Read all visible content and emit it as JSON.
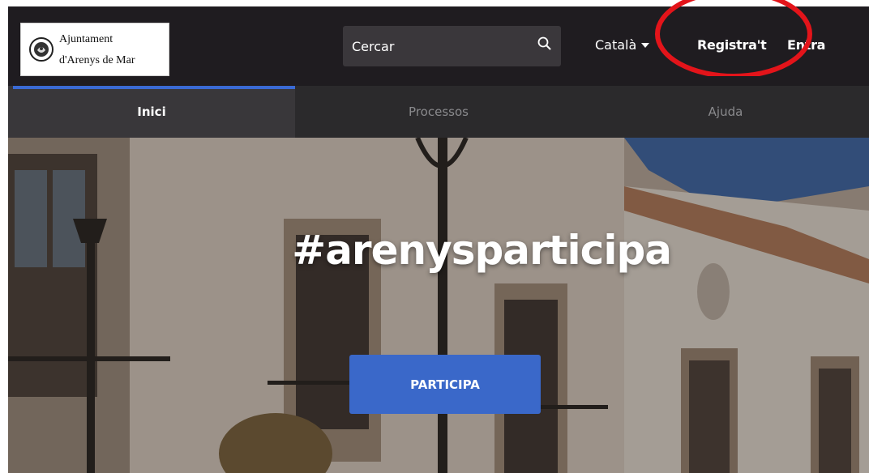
{
  "logo": {
    "line1": "Ajuntament",
    "line2": "d'Arenys de Mar",
    "seal_icon": "municipal-seal-icon"
  },
  "search": {
    "placeholder": "Cercar",
    "icon": "search-icon"
  },
  "language": {
    "label": "Català",
    "icon": "caret-down-icon"
  },
  "auth": {
    "register_label": "Registra't",
    "login_label": "Entra"
  },
  "annotation": {
    "color": "#e3141a",
    "shape": "ellipse around Registra't link"
  },
  "nav": {
    "tabs": [
      {
        "label": "Inici",
        "active": true
      },
      {
        "label": "Processos",
        "active": false
      },
      {
        "label": "Ajuda",
        "active": false
      }
    ]
  },
  "hero": {
    "title": "#arenysparticipa",
    "cta_label": "PARTICIPA"
  },
  "colors": {
    "header_bg": "#1f1c20",
    "nav_bg": "#2b2a2c",
    "nav_active_bg": "#39373a",
    "accent": "#3a6ad4",
    "cta_bg": "#3a68c9"
  }
}
